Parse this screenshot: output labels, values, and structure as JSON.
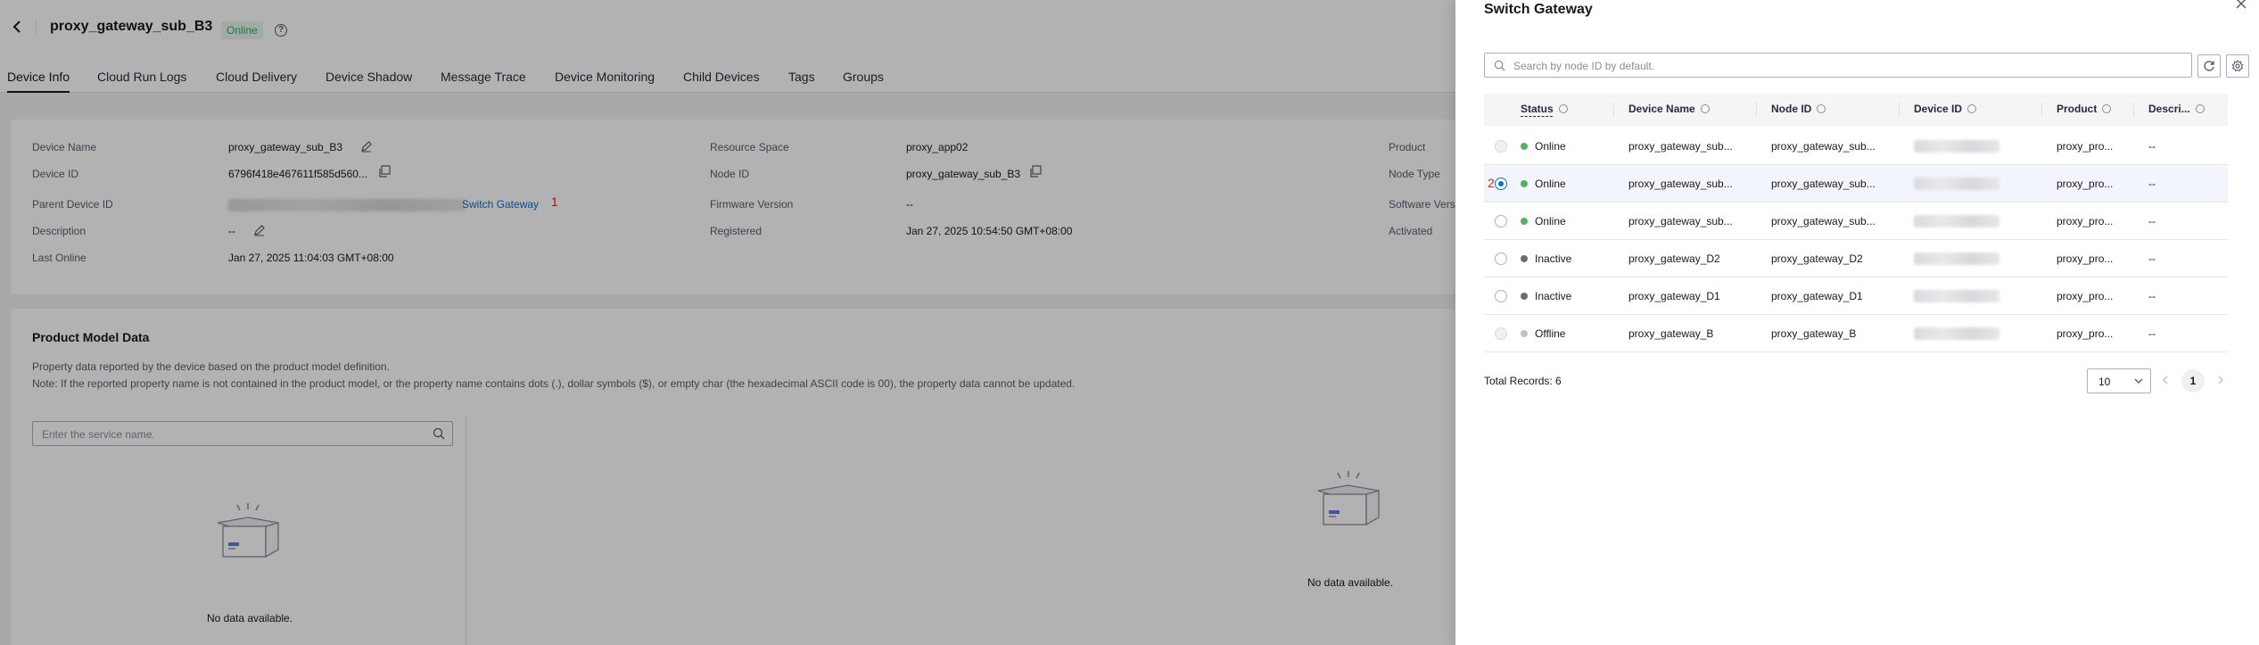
{
  "header": {
    "title": "proxy_gateway_sub_B3",
    "status": "Online",
    "help": "?"
  },
  "tabs": [
    {
      "label": "Device Info"
    },
    {
      "label": "Cloud Run Logs"
    },
    {
      "label": "Cloud Delivery"
    },
    {
      "label": "Device Shadow"
    },
    {
      "label": "Message Trace"
    },
    {
      "label": "Device Monitoring"
    },
    {
      "label": "Child Devices"
    },
    {
      "label": "Tags"
    },
    {
      "label": "Groups"
    }
  ],
  "info": {
    "device_name_label": "Device Name",
    "device_name": "proxy_gateway_sub_B3",
    "device_id_label": "Device ID",
    "device_id": "6796f418e467611f585d560...",
    "parent_label": "Parent Device ID",
    "switch_gateway": "Switch Gateway",
    "marker_1": "1",
    "description_label": "Description",
    "description": "--",
    "last_online_label": "Last Online",
    "last_online": "Jan 27, 2025 11:04:03 GMT+08:00",
    "resource_space_label": "Resource Space",
    "resource_space": "proxy_app02",
    "node_id_label": "Node ID",
    "node_id": "proxy_gateway_sub_B3",
    "firmware_label": "Firmware Version",
    "firmware": "--",
    "registered_label": "Registered",
    "registered": "Jan 27, 2025 10:54:50 GMT+08:00",
    "product_label": "Product",
    "node_type_label": "Node Type",
    "software_label": "Software Vers",
    "activated_label": "Activated"
  },
  "model": {
    "title": "Product Model Data",
    "desc1": "Property data reported by the device based on the product model definition.",
    "desc2": "Note: If the reported property name is not contained in the product model, or the property name contains dots (.), dollar symbols ($), or empty char (the hexadecimal ASCII code is 00), the property data cannot be updated.",
    "search_placeholder": "Enter the service name.",
    "empty_left": "No data available.",
    "empty_right": "No data available."
  },
  "drawer": {
    "title": "Switch Gateway",
    "search_placeholder": "Search by node ID by default.",
    "columns": [
      "Status",
      "Device Name",
      "Node ID",
      "Device ID",
      "Product",
      "Descri..."
    ],
    "marker_2": "2",
    "rows": [
      {
        "status": "Online",
        "name": "proxy_gateway_sub...",
        "node": "proxy_gateway_sub...",
        "product": "proxy_pro...",
        "desc": "--"
      },
      {
        "status": "Online",
        "name": "proxy_gateway_sub...",
        "node": "proxy_gateway_sub...",
        "product": "proxy_pro...",
        "desc": "--"
      },
      {
        "status": "Online",
        "name": "proxy_gateway_sub...",
        "node": "proxy_gateway_sub...",
        "product": "proxy_pro...",
        "desc": "--"
      },
      {
        "status": "Inactive",
        "name": "proxy_gateway_D2",
        "node": "proxy_gateway_D2",
        "product": "proxy_pro...",
        "desc": "--"
      },
      {
        "status": "Inactive",
        "name": "proxy_gateway_D1",
        "node": "proxy_gateway_D1",
        "product": "proxy_pro...",
        "desc": "--"
      },
      {
        "status": "Offline",
        "name": "proxy_gateway_B",
        "node": "proxy_gateway_B",
        "product": "proxy_pro...",
        "desc": "--"
      }
    ],
    "total": "Total Records: 6",
    "page_size": "10",
    "current_page": "1"
  },
  "colors": {
    "online": "#52b35d",
    "inactive": "#6d6d6d",
    "offline": "#c2c2c2",
    "link": "#0a6ed1"
  }
}
